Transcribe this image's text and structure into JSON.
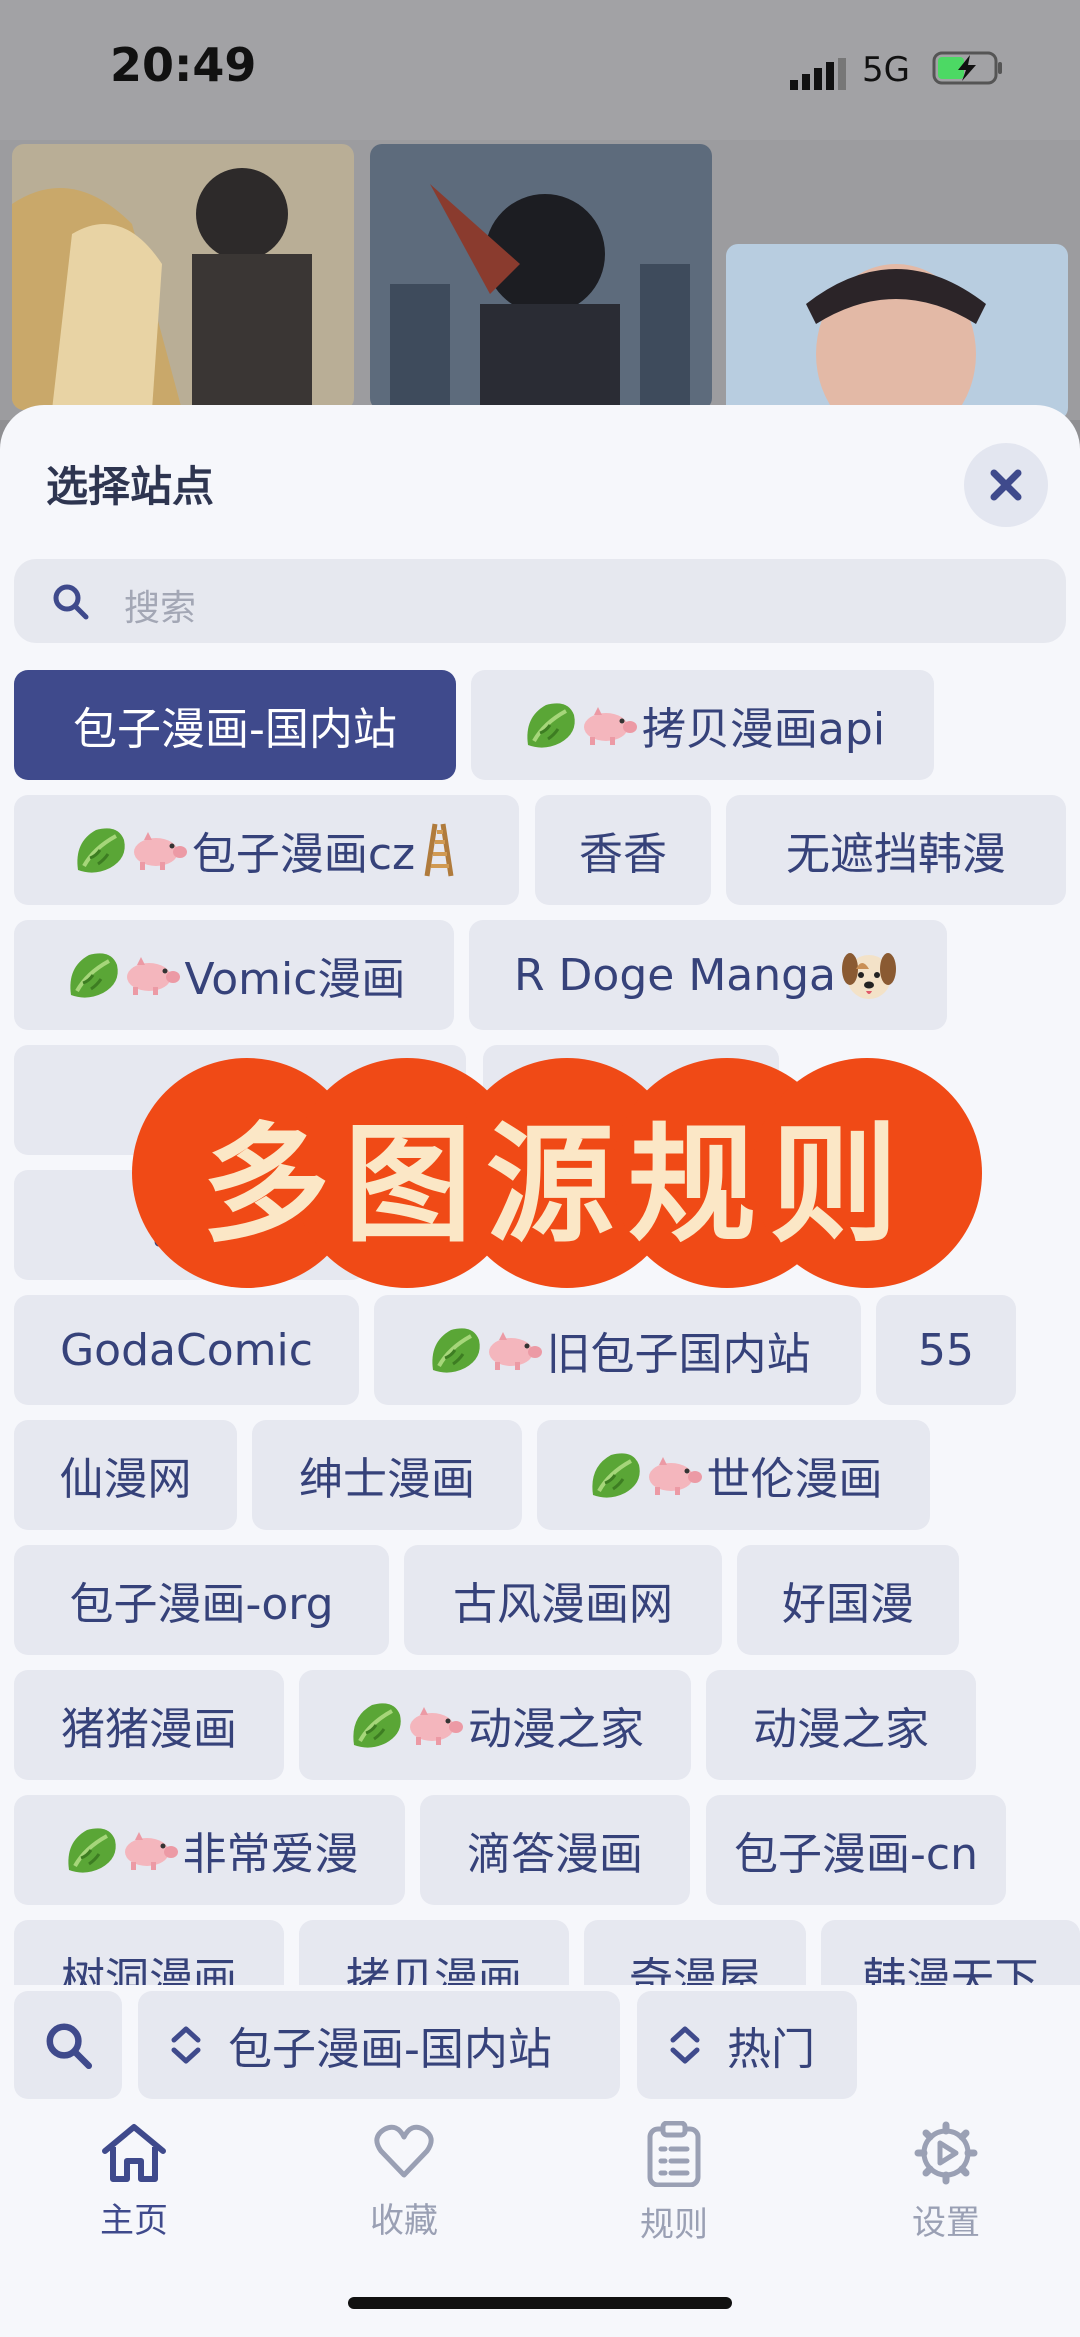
{
  "status_bar": {
    "time": "20:49",
    "network": "5G"
  },
  "sheet": {
    "title": "选择站点",
    "search_placeholder": "搜索"
  },
  "sites": [
    {
      "label": "包子漫画-国内站",
      "selected": true
    },
    {
      "label": "拷贝漫画api",
      "emoji": true
    },
    {
      "label": "包子漫画cz",
      "emoji": true,
      "trail": "ladder"
    },
    {
      "label": "香香"
    },
    {
      "label": "无遮挡韩漫"
    },
    {
      "label": "Vomic漫画",
      "emoji": true
    },
    {
      "label": "R Doge Manga",
      "trail": "dog"
    },
    {
      "label": "",
      "emoji": true
    },
    {
      "label": ""
    },
    {
      "label": "包子"
    },
    {
      "label": "GodaComic"
    },
    {
      "label": "旧包子国内站",
      "emoji": true
    },
    {
      "label": "55"
    },
    {
      "label": "仙漫网"
    },
    {
      "label": "绅士漫画"
    },
    {
      "label": "世伦漫画",
      "emoji": true
    },
    {
      "label": "包子漫画-org"
    },
    {
      "label": "古风漫画网"
    },
    {
      "label": "好国漫"
    },
    {
      "label": "猪猪漫画"
    },
    {
      "label": "动漫之家",
      "emoji": true
    },
    {
      "label": "动漫之家"
    },
    {
      "label": "非常爱漫",
      "emoji": true
    },
    {
      "label": "滴答漫画"
    },
    {
      "label": "包子漫画-cn"
    },
    {
      "label": "树洞漫画"
    },
    {
      "label": "拷贝漫画"
    },
    {
      "label": "奇漫屋"
    },
    {
      "label": "韩漫天下"
    }
  ],
  "banner": {
    "text": "多图源规则",
    "color": "#f04a16"
  },
  "bottom_bar": {
    "site_selector": "包子漫画-国内站",
    "category_selector": "热门"
  },
  "tabs": [
    {
      "label": "主页",
      "icon": "home-icon",
      "active": true
    },
    {
      "label": "收藏",
      "icon": "heart-icon"
    },
    {
      "label": "规则",
      "icon": "clipboard-icon"
    },
    {
      "label": "设置",
      "icon": "gear-icon"
    }
  ],
  "colors": {
    "accent": "#3f4a8c",
    "chip_bg": "#e6e8f0",
    "chip_text": "#36427a"
  }
}
